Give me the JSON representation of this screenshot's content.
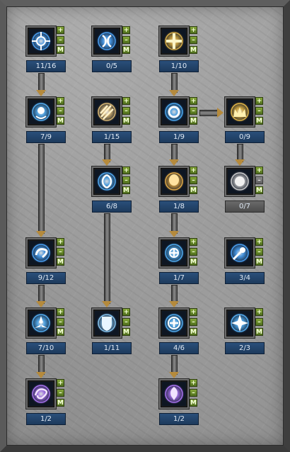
{
  "buttons": {
    "plus": "+",
    "minus": "–",
    "max": "M"
  },
  "skills": [
    {
      "id": "a1",
      "level": "11/16",
      "icon": "crosshair-orb-icon",
      "color": "#4fa9ff"
    },
    {
      "id": "b1",
      "level": "0/5",
      "icon": "split-orb-icon",
      "color": "#4fa9ff"
    },
    {
      "id": "c1",
      "level": "1/10",
      "icon": "golden-cross-icon",
      "color": "#e6b84a"
    },
    {
      "id": "a2",
      "level": "7/9",
      "icon": "blue-ring-orb-icon",
      "color": "#5ab8ff"
    },
    {
      "id": "b2",
      "level": "1/15",
      "icon": "claw-slash-icon",
      "color": "#e7c27a"
    },
    {
      "id": "c2",
      "level": "1/9",
      "icon": "vortex-ring-icon",
      "color": "#4fb3ff"
    },
    {
      "id": "d2",
      "level": "0/9",
      "icon": "golden-crown-icon",
      "color": "#f0c04a"
    },
    {
      "id": "b3",
      "level": "6/8",
      "icon": "twin-wing-icon",
      "color": "#58b4ff"
    },
    {
      "id": "c3",
      "level": "1/8",
      "icon": "amber-orb-icon",
      "color": "#f0b54a"
    },
    {
      "id": "d3",
      "level": "0/7",
      "icon": "pale-orb-icon",
      "color": "#d8d8d8"
    },
    {
      "id": "a4",
      "level": "9/12",
      "icon": "blue-swirl-icon",
      "color": "#4fa9ff"
    },
    {
      "id": "c4",
      "level": "1/7",
      "icon": "crossed-orb-icon",
      "color": "#55b7ff"
    },
    {
      "id": "d4",
      "level": "3/4",
      "icon": "comet-orb-icon",
      "color": "#4fa9ff"
    },
    {
      "id": "a5",
      "level": "7/10",
      "icon": "tri-blade-icon",
      "color": "#5ab8ff"
    },
    {
      "id": "b5",
      "level": "1/11",
      "icon": "frost-shield-icon",
      "color": "#8fd2ff"
    },
    {
      "id": "c5",
      "level": "4/6",
      "icon": "plus-ring-icon",
      "color": "#55b7ff"
    },
    {
      "id": "d5",
      "level": "2/3",
      "icon": "four-point-star-icon",
      "color": "#5ab8ff"
    },
    {
      "id": "a6",
      "level": "1/2",
      "icon": "violet-swirl-icon",
      "color": "#b57bff"
    },
    {
      "id": "c6",
      "level": "1/2",
      "icon": "violet-crest-icon",
      "color": "#b57bff"
    }
  ]
}
